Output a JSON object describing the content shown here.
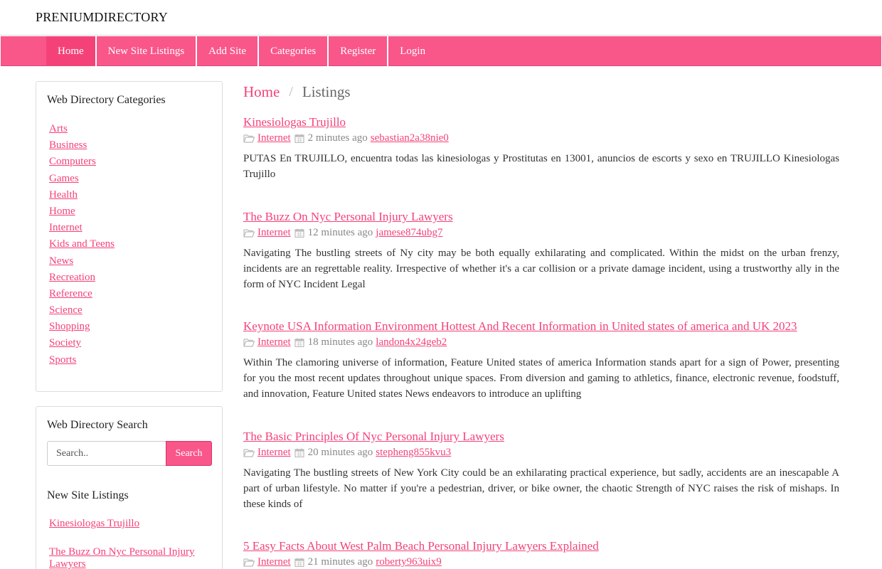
{
  "brand": "PRENIUMDIRECTORY",
  "nav": [
    {
      "label": "Home"
    },
    {
      "label": "New Site Listings"
    },
    {
      "label": "Add Site"
    },
    {
      "label": "Categories"
    },
    {
      "label": "Register"
    },
    {
      "label": "Login"
    }
  ],
  "sidebar": {
    "categories_title": "Web Directory Categories",
    "categories": [
      "Arts",
      "Business",
      "Computers",
      "Games",
      "Health",
      "Home",
      "Internet",
      "Kids and Teens",
      "News",
      "Recreation",
      "Reference",
      "Science",
      "Shopping",
      "Society",
      "Sports"
    ],
    "search_title": "Web Directory Search",
    "search_placeholder": "Search..",
    "search_button": "Search",
    "new_listings_title": "New Site Listings",
    "new_listings": [
      "Kinesiologas Trujillo",
      "The Buzz On Nyc Personal Injury Lawyers"
    ]
  },
  "breadcrumb": {
    "home": "Home",
    "separator": "/",
    "current": "Listings"
  },
  "colors": {
    "accent": "#f9568a",
    "link": "#f44278"
  },
  "listings": [
    {
      "title": "Kinesiologas Trujillo",
      "category": "Internet",
      "time": "2 minutes ago",
      "author": "sebastian2a38nie0",
      "description": "PUTAS En TRUJILLO, encuentra todas las kinesiologas y Prostitutas en 13001, anuncios de escorts y sexo en TRUJILLO Kinesiologas Trujillo"
    },
    {
      "title": "The Buzz On Nyc Personal Injury Lawyers",
      "category": "Internet",
      "time": "12 minutes ago",
      "author": "jamese874ubg7",
      "description": "Navigating The bustling streets of Ny city may be both equally exhilarating and complicated. Within the midst on the urban frenzy, incidents are an regrettable reality. Irrespective of whether it's a car collision or a private damage incident, using a trustworthy ally in the form of NYC Incident Legal"
    },
    {
      "title": "Keynote USA Information Environment Hottest And Recent Information in United states of america and UK 2023",
      "category": "Internet",
      "time": "18 minutes ago",
      "author": "landon4x24geb2",
      "description": "Within The clamoring universe of information, Feature United states of america Information stands apart for a sign of Power, presenting for you the most recent updates throughout unique spaces. From diversion and gaming to athletics, finance, electronic revenue, foodstuff, and innovation, Feature United states News endeavors to introduce an uplifting"
    },
    {
      "title": "The Basic Principles Of Nyc Personal Injury Lawyers",
      "category": "Internet",
      "time": "20 minutes ago",
      "author": "stepheng855kvu3",
      "description": "Navigating The bustling streets of New York City could be an exhilarating practical experience, but sadly, accidents are an inescapable A part of urban lifestyle. No matter if you're a pedestrian, driver, or bike owner, the chaotic Strength of NYC raises the risk of mishaps. In these kinds of"
    },
    {
      "title": "5 Easy Facts About West Palm Beach Personal Injury Lawyers Explained",
      "category": "Internet",
      "time": "21 minutes ago",
      "author": "roberty963uix9",
      "description": ""
    }
  ]
}
